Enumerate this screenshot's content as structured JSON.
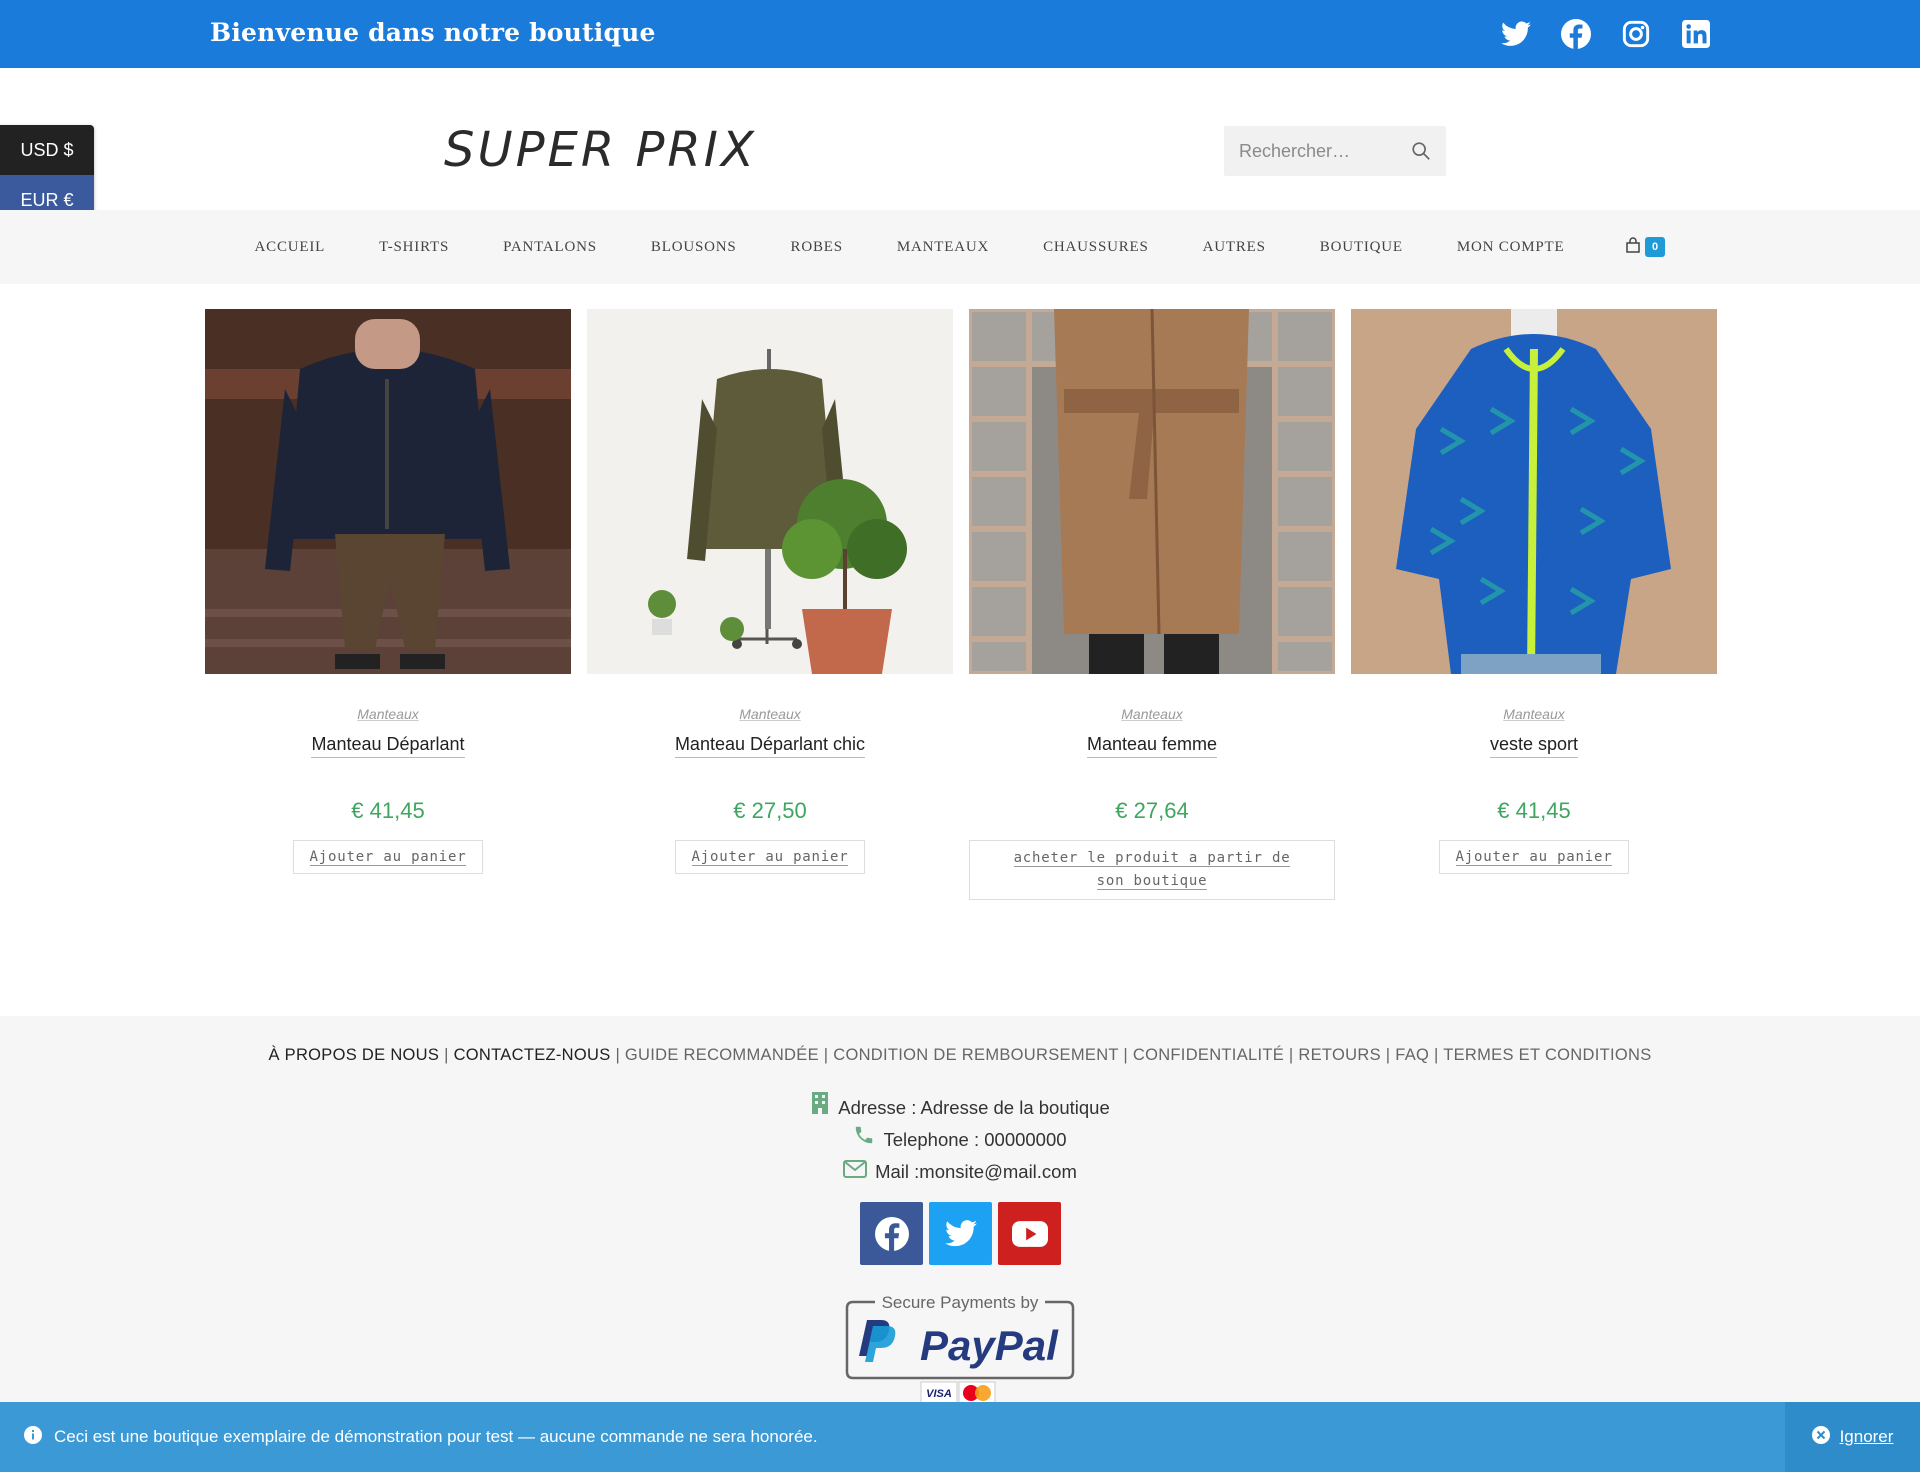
{
  "topbar": {
    "welcome": "Bienvenue dans notre boutique",
    "social_icons": [
      "twitter-icon",
      "facebook-icon",
      "instagram-icon",
      "linkedin-icon"
    ],
    "bg_color": "#1a7bdb"
  },
  "header": {
    "logo": "SUPER PRIX",
    "search_placeholder": "Rechercher…"
  },
  "currency": {
    "usd": "USD $",
    "eur": "EUR €"
  },
  "nav": {
    "items": [
      "ACCUEIL",
      "T-SHIRTS",
      "PANTALONS",
      "BLOUSONS",
      "ROBES",
      "MANTEAUX",
      "CHAUSSURES",
      "AUTRES",
      "BOUTIQUE",
      "MON COMPTE"
    ],
    "cart_count": "0"
  },
  "products": [
    {
      "category": "Manteaux",
      "title": "Manteau Déparlant",
      "price": "€ 41,45",
      "button": "Ajouter au panier"
    },
    {
      "category": "Manteaux",
      "title": "Manteau Déparlant chic",
      "price": "€ 27,50",
      "button": "Ajouter au panier"
    },
    {
      "category": "Manteaux",
      "title": "Manteau femme",
      "price": "€ 27,64",
      "button": "acheter le produit a partir de son boutique"
    },
    {
      "category": "Manteaux",
      "title": "veste sport",
      "price": "€ 41,45",
      "button": "Ajouter au panier"
    }
  ],
  "footer": {
    "link_about": "À PROPOS DE NOUS",
    "link_contact": "CONTACTEZ-NOUS",
    "link_guide": "GUIDE RECOMMANDÉE",
    "link_refund": "CONDITION DE REMBOURSEMENT",
    "link_privacy": "CONFIDENTIALITÉ",
    "link_returns": "RETOURS",
    "link_faq": "FAQ",
    "link_terms": "TERMES ET CONDITIONS",
    "address": "Adresse : Adresse de la boutique",
    "phone": "Telephone : 00000000",
    "mail": "Mail :monsite@mail.com",
    "social_icons": [
      "facebook-icon",
      "twitter-icon",
      "youtube-icon"
    ],
    "paypal_caption": "Secure Payments by",
    "paypal_brand": "PayPal"
  },
  "notice": {
    "message": "Ceci est une boutique exemplaire de démonstration pour test — aucune commande ne sera honorée.",
    "dismiss": "Ignorer"
  },
  "colors": {
    "accent": "#1a7bdb",
    "price": "#3fa55f",
    "notice": "#3b9ad5"
  }
}
